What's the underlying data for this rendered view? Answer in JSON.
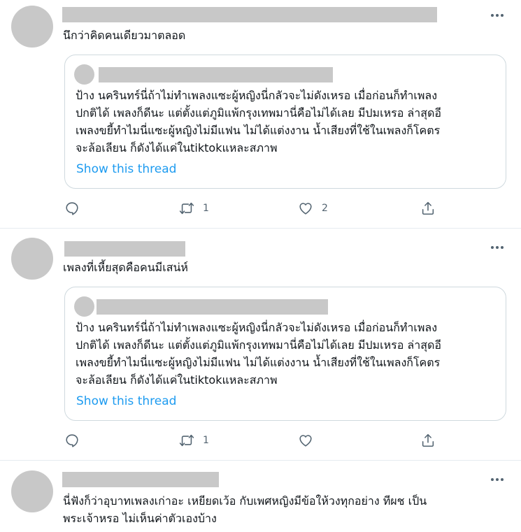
{
  "tweets": [
    {
      "text_lines": [
        "นึกว่าคิดคนเดียวมาตลอด"
      ],
      "quote": {
        "text_lines": [
          "ป้าง นครินทร์นี่ถ้าไม่ทำเพลงแซะผู้หญิงนี่กลัวจะไม่ดังเหรอ เมื่อก่อนก็ทำเพลง",
          "ปกติได้ เพลงก็ดีนะ แต่ตั้งแต่ภูมิแพ้กรุงเทพมานี่คือไม่ได้เลย มีปมเหรอ ล่าสุดอี",
          "เพลงขยี้ทำไมนี่แซะผู้หญิงไม่มีแฟน ไม่ได้แต่งงาน น้ำเสียงที่ใช้ในเพลงก็โคตร",
          "จะล้อเลียน ก็ดังได้แค่ในtiktokแหละสภาพ"
        ],
        "link": "Show this thread"
      },
      "retweets": "1",
      "likes": "2"
    },
    {
      "text_lines": [
        "เพลงที่เหี้ยสุดคือคนมีเสน่ห์"
      ],
      "quote": {
        "text_lines": [
          "ป้าง นครินทร์นี่ถ้าไม่ทำเพลงแซะผู้หญิงนี่กลัวจะไม่ดังเหรอ เมื่อก่อนก็ทำเพลง",
          "ปกติได้ เพลงก็ดีนะ แต่ตั้งแต่ภูมิแพ้กรุงเทพมานี่คือไม่ได้เลย มีปมเหรอ ล่าสุดอี",
          "เพลงขยี้ทำไมนี่แซะผู้หญิงไม่มีแฟน ไม่ได้แต่งงาน น้ำเสียงที่ใช้ในเพลงก็โคตร",
          "จะล้อเลียน ก็ดังได้แค่ในtiktokแหละสภาพ"
        ],
        "link": "Show this thread"
      },
      "retweets": "1",
      "likes": ""
    },
    {
      "text_lines": [
        "นี่ฟังก็ว่าอุบาทเพลงเก่าอะ เหยียดเว้อ กับเพศหญิงมีข้อให้วงทุกอย่าง ทีผช เป็น",
        "พระเจ้าหรอ ไม่เห็นค่าตัวเองบ้าง"
      ]
    }
  ],
  "colors": {
    "placeholder": "#c8c8c8",
    "link": "#1d9bf0",
    "icon": "#536471",
    "border": "#cfd9de"
  },
  "icons": [
    "more-icon",
    "reply-icon",
    "retweet-icon",
    "like-icon",
    "share-icon"
  ]
}
